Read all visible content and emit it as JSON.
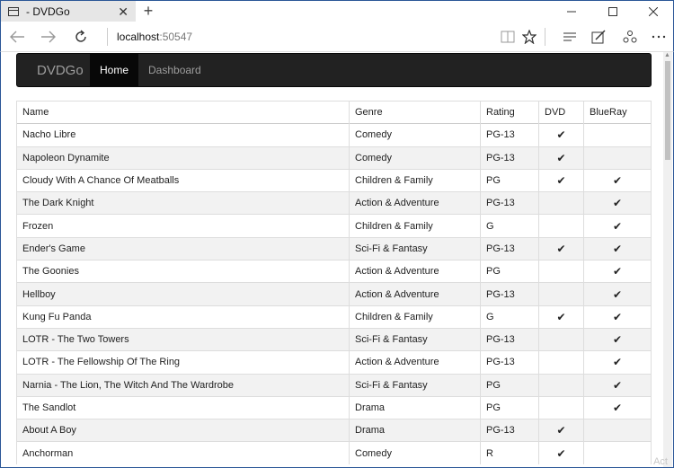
{
  "browser": {
    "tab_title": "- DVDGo",
    "tab_close": "✕",
    "new_tab": "+",
    "url_host": "localhost",
    "url_port": ":50547",
    "icons": [
      "back-icon",
      "forward-icon",
      "refresh-icon",
      "reading-view-icon",
      "favorite-star-icon",
      "hub-icon",
      "web-note-icon",
      "share-icon"
    ]
  },
  "navbar": {
    "brand": "DVDGo",
    "items": [
      {
        "label": "Home",
        "active": true
      },
      {
        "label": "Dashboard",
        "active": false
      }
    ]
  },
  "table": {
    "headers": [
      "Name",
      "Genre",
      "Rating",
      "DVD",
      "BlueRay"
    ],
    "check_glyph": "✔",
    "rows": [
      {
        "name": "Nacho Libre",
        "genre": "Comedy",
        "rating": "PG-13",
        "dvd": true,
        "blueray": false
      },
      {
        "name": "Napoleon Dynamite",
        "genre": "Comedy",
        "rating": "PG-13",
        "dvd": true,
        "blueray": false
      },
      {
        "name": "Cloudy With A Chance Of Meatballs",
        "genre": "Children & Family",
        "rating": "PG",
        "dvd": true,
        "blueray": true
      },
      {
        "name": "The Dark Knight",
        "genre": "Action & Adventure",
        "rating": "PG-13",
        "dvd": false,
        "blueray": true
      },
      {
        "name": "Frozen",
        "genre": "Children & Family",
        "rating": "G",
        "dvd": false,
        "blueray": true
      },
      {
        "name": "Ender's Game",
        "genre": "Sci-Fi & Fantasy",
        "rating": "PG-13",
        "dvd": true,
        "blueray": true
      },
      {
        "name": "The Goonies",
        "genre": "Action & Adventure",
        "rating": "PG",
        "dvd": false,
        "blueray": true
      },
      {
        "name": "Hellboy",
        "genre": "Action & Adventure",
        "rating": "PG-13",
        "dvd": false,
        "blueray": true
      },
      {
        "name": "Kung Fu Panda",
        "genre": "Children & Family",
        "rating": "G",
        "dvd": true,
        "blueray": true
      },
      {
        "name": "LOTR - The Two Towers",
        "genre": "Sci-Fi & Fantasy",
        "rating": "PG-13",
        "dvd": false,
        "blueray": true
      },
      {
        "name": "LOTR - The Fellowship Of The Ring",
        "genre": "Action & Adventure",
        "rating": "PG-13",
        "dvd": false,
        "blueray": true
      },
      {
        "name": "Narnia - The Lion, The Witch And The Wardrobe",
        "genre": "Sci-Fi & Fantasy",
        "rating": "PG",
        "dvd": false,
        "blueray": true
      },
      {
        "name": "The Sandlot",
        "genre": "Drama",
        "rating": "PG",
        "dvd": false,
        "blueray": true
      },
      {
        "name": "About A Boy",
        "genre": "Drama",
        "rating": "PG-13",
        "dvd": true,
        "blueray": false
      },
      {
        "name": "Anchorman",
        "genre": "Comedy",
        "rating": "R",
        "dvd": true,
        "blueray": false
      }
    ]
  },
  "watermark": "Act"
}
